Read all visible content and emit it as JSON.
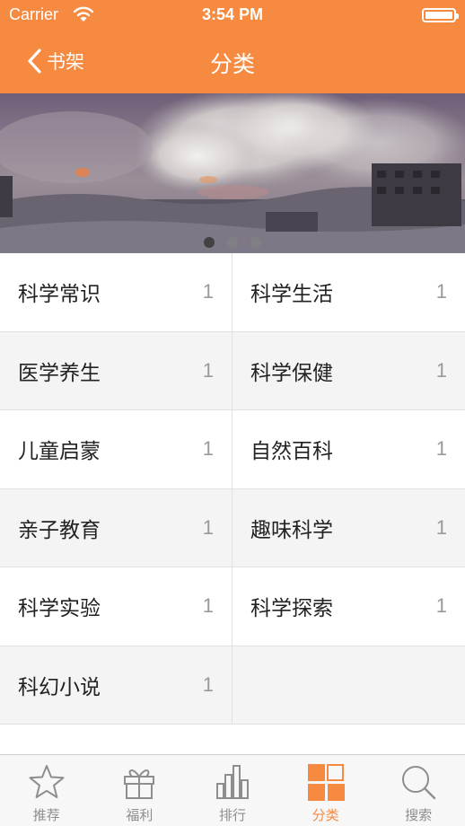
{
  "status_bar": {
    "carrier": "Carrier",
    "time": "3:54 PM"
  },
  "nav": {
    "back_label": "书架",
    "title": "分类"
  },
  "banner": {
    "page_count": 3,
    "active_page": 1
  },
  "categories": [
    {
      "name": "科学常识",
      "count": "1"
    },
    {
      "name": "科学生活",
      "count": "1"
    },
    {
      "name": "医学养生",
      "count": "1"
    },
    {
      "name": "科学保健",
      "count": "1"
    },
    {
      "name": "儿童启蒙",
      "count": "1"
    },
    {
      "name": "自然百科",
      "count": "1"
    },
    {
      "name": "亲子教育",
      "count": "1"
    },
    {
      "name": "趣味科学",
      "count": "1"
    },
    {
      "name": "科学实验",
      "count": "1"
    },
    {
      "name": "科学探索",
      "count": "1"
    },
    {
      "name": "科幻小说",
      "count": "1"
    }
  ],
  "tabbar": {
    "items": [
      {
        "label": "推荐",
        "icon": "star-icon"
      },
      {
        "label": "福利",
        "icon": "gift-icon"
      },
      {
        "label": "排行",
        "icon": "bar-chart-icon"
      },
      {
        "label": "分类",
        "icon": "grid-icon",
        "active": true
      },
      {
        "label": "搜索",
        "icon": "search-icon"
      }
    ]
  },
  "colors": {
    "accent": "#f58a40",
    "inactive": "#8e8e8e"
  }
}
